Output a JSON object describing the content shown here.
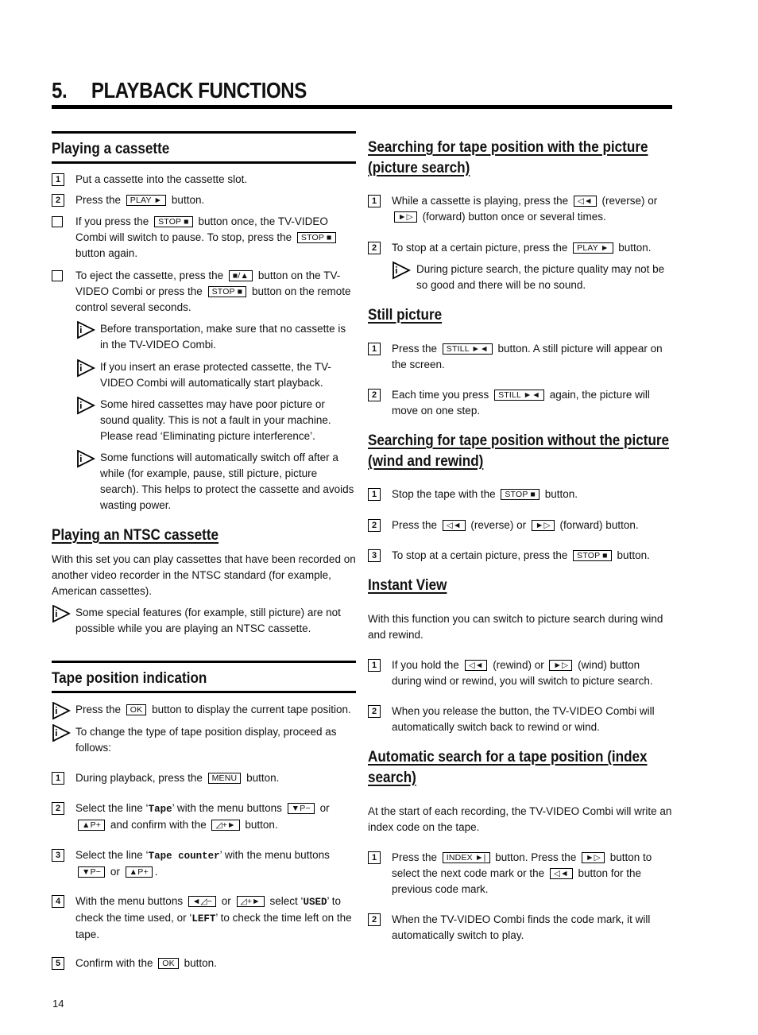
{
  "page": {
    "chapter_number": "5.",
    "chapter_title": "PLAYBACK FUNCTIONS",
    "page_number": "14"
  },
  "icons": {
    "info": "info-triangle-icon",
    "step_box": "numbered-step-box",
    "bullet_box": "square-bullet-box"
  },
  "left": {
    "playing_cassette": {
      "heading": "Playing a cassette",
      "steps": [
        {
          "num": "1",
          "text": "Put a cassette into the cassette slot."
        },
        {
          "num": "2",
          "pre": "Press the",
          "key": "PLAY ►",
          "post": "button."
        }
      ],
      "bullets": [
        {
          "pre": "If you press the",
          "key1": "STOP ■",
          "mid": "button once, the TV-VIDEO Combi will switch to pause. To stop, press the",
          "key2": "STOP ■",
          "post": "button again."
        },
        {
          "pre": "To eject the cassette, press the",
          "key1": "■/▲",
          "mid": "button on the TV-VIDEO Combi or press the",
          "key2": "STOP ■",
          "post": "button on the remote control several seconds."
        }
      ],
      "notes": [
        "Before transportation, make sure that no cassette is in the TV-VIDEO Combi.",
        "If you insert an erase protected cassette, the TV-VIDEO Combi will automatically start playback.",
        "Some hired cassettes may have poor picture or sound quality. This is not a fault in your machine. Please read ‘Eliminating picture interference’.",
        "Some functions will automatically switch off after a while (for example, pause, still picture, picture search). This helps to protect the cassette and avoids wasting power."
      ]
    },
    "ntsc": {
      "heading": "Playing an NTSC cassette",
      "intro": "With this set you can play cassettes that have been recorded on another video recorder in the NTSC standard (for example, American cassettes).",
      "note": "Some special features (for example, still picture) are not possible while you are playing an NTSC cassette."
    },
    "tape_position": {
      "heading": "Tape position indication",
      "note1": {
        "pre": "Press the",
        "key": "OK",
        "post": "button to display the current tape position."
      },
      "note2": "To change the type of tape position display, proceed as follows:",
      "steps": [
        {
          "num": "1",
          "pre": "During playback, press the",
          "key1": "MENU",
          "post": "button."
        },
        {
          "num": "2",
          "pre": "Select the line ‘",
          "mono": "Tape",
          "pre2": "’ with the menu buttons",
          "key1": "▼P−",
          "mid": "or",
          "key2": "▲P+",
          "post": "and confirm with the",
          "key3": "◿+►",
          "post2": "button."
        },
        {
          "num": "3",
          "pre": "Select the line ‘",
          "mono": "Tape counter",
          "pre2": "’ with the menu buttons",
          "key1": "▼P−",
          "mid": "or",
          "key2": "▲P+",
          "post": "."
        },
        {
          "num": "4",
          "pre": "With the menu buttons",
          "key1": "◄◿−",
          "mid": "or",
          "key2": "◿+►",
          "post": "select ‘",
          "mono1": "USED",
          "post2": "’ to check the time used, or ‘",
          "mono2": "LEFT",
          "post3": "’ to check the time left on the tape."
        },
        {
          "num": "5",
          "pre": "Confirm with the",
          "key1": "OK",
          "post": "button."
        }
      ]
    }
  },
  "right": {
    "picture_search": {
      "heading": "Searching for tape position with the picture (picture search)",
      "steps": [
        {
          "num": "1",
          "pre": "While a cassette is playing, press the",
          "key1": "◁◄",
          "mid": "(reverse) or",
          "key2": "►▷",
          "post": "(forward) button once or several times."
        },
        {
          "num": "2",
          "pre": "To stop at a certain picture, press the",
          "key1": "PLAY ►",
          "post": "button."
        }
      ],
      "note": "During picture search, the picture quality may not be so good and there will be no sound."
    },
    "still_picture": {
      "heading": "Still picture",
      "steps": [
        {
          "num": "1",
          "pre": "Press the",
          "key1": "STILL ►◄",
          "post": "button. A still picture will appear on the screen."
        },
        {
          "num": "2",
          "pre": "Each time you press",
          "key1": "STILL ►◄",
          "post": "again, the picture will move on one step."
        }
      ]
    },
    "wind_rewind": {
      "heading": "Searching for tape position without the picture (wind and rewind)",
      "steps": [
        {
          "num": "1",
          "pre": "Stop the tape with the",
          "key1": "STOP ■",
          "post": "button."
        },
        {
          "num": "2",
          "pre": "Press the",
          "key1": "◁◄",
          "mid": "(reverse) or",
          "key2": "►▷",
          "post": "(forward) button."
        },
        {
          "num": "3",
          "pre": "To stop at a certain picture, press the",
          "key1": "STOP ■",
          "post": "button."
        }
      ]
    },
    "instant_view": {
      "heading": "Instant View",
      "intro": "With this function you can switch to picture search during wind and rewind.",
      "steps": [
        {
          "num": "1",
          "pre": "If you hold the",
          "key1": "◁◄",
          "mid": "(rewind) or",
          "key2": "►▷",
          "post": "(wind) button during wind or rewind, you will switch to picture search."
        },
        {
          "num": "2",
          "text": "When you release the button, the TV-VIDEO Combi will automatically switch back to rewind or wind."
        }
      ]
    },
    "index_search": {
      "heading": "Automatic search for a tape position (index search)",
      "intro": "At the start of each recording, the TV-VIDEO Combi will write an index code on the tape.",
      "steps": [
        {
          "num": "1",
          "pre": "Press the",
          "key1": "INDEX ►|",
          "mid": "button. Press the",
          "key2": "►▷",
          "mid2": "button to select the next code mark or the",
          "key3": "◁◄",
          "post": "button for the previous code mark."
        },
        {
          "num": "2",
          "text": "When the TV-VIDEO Combi finds the code mark, it will automatically switch to play."
        }
      ]
    }
  }
}
